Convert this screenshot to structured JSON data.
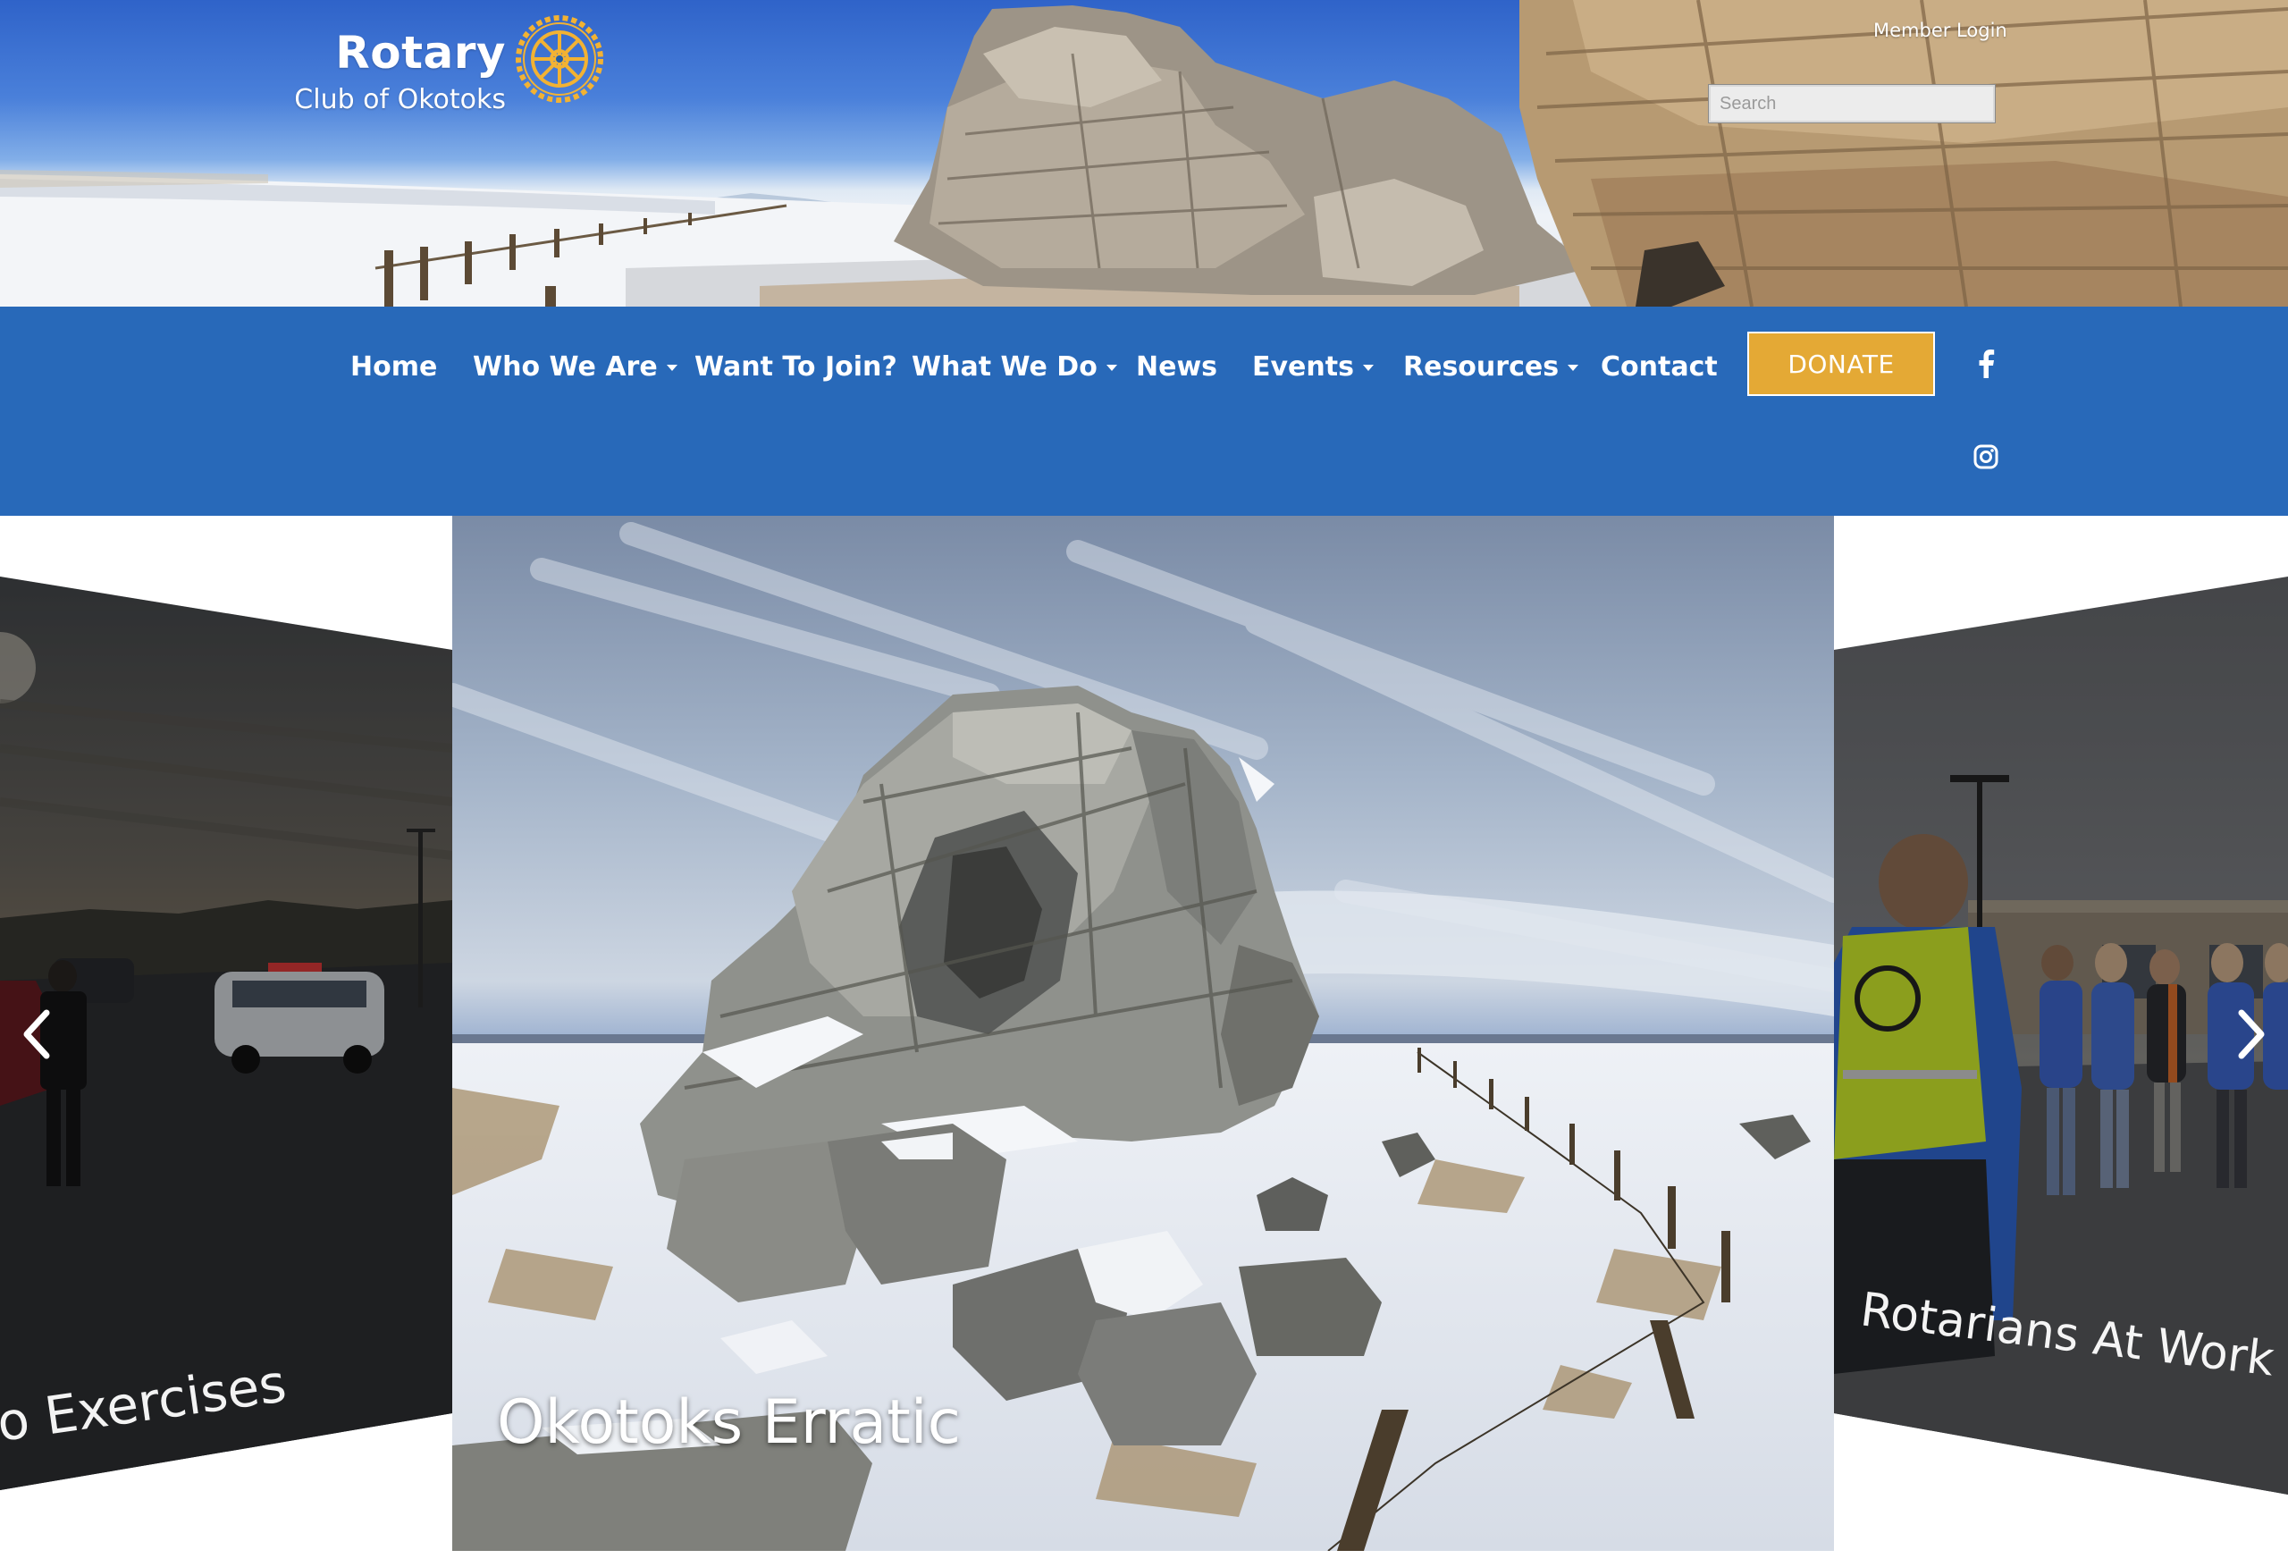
{
  "header": {
    "logo": {
      "brand": "Rotary",
      "subtitle": "Club of Okotoks"
    },
    "member_login": "Member Login",
    "search": {
      "placeholder": "Search",
      "value": ""
    }
  },
  "nav": {
    "items": [
      {
        "label": "Home",
        "dropdown": false
      },
      {
        "label": "Who We Are",
        "dropdown": true
      },
      {
        "label": "Want To Join?",
        "dropdown": false
      },
      {
        "label": "What We Do",
        "dropdown": true
      },
      {
        "label": "News",
        "dropdown": false
      },
      {
        "label": "Events",
        "dropdown": true
      },
      {
        "label": "Resources",
        "dropdown": true
      },
      {
        "label": "Contact",
        "dropdown": false
      }
    ],
    "donate_label": "DONATE",
    "social": [
      "facebook-icon",
      "instagram-icon"
    ]
  },
  "carousel": {
    "left_caption": "o Exercises",
    "main_caption": "Okotoks Erratic",
    "right_caption": "Rotarians At Work",
    "prev_icon": "chevron-left-icon",
    "next_icon": "chevron-right-icon"
  },
  "colors": {
    "nav_blue": "#2869b9",
    "donate_gold": "#e4a935",
    "rotary_gold": "#f2b233",
    "white": "#ffffff"
  }
}
